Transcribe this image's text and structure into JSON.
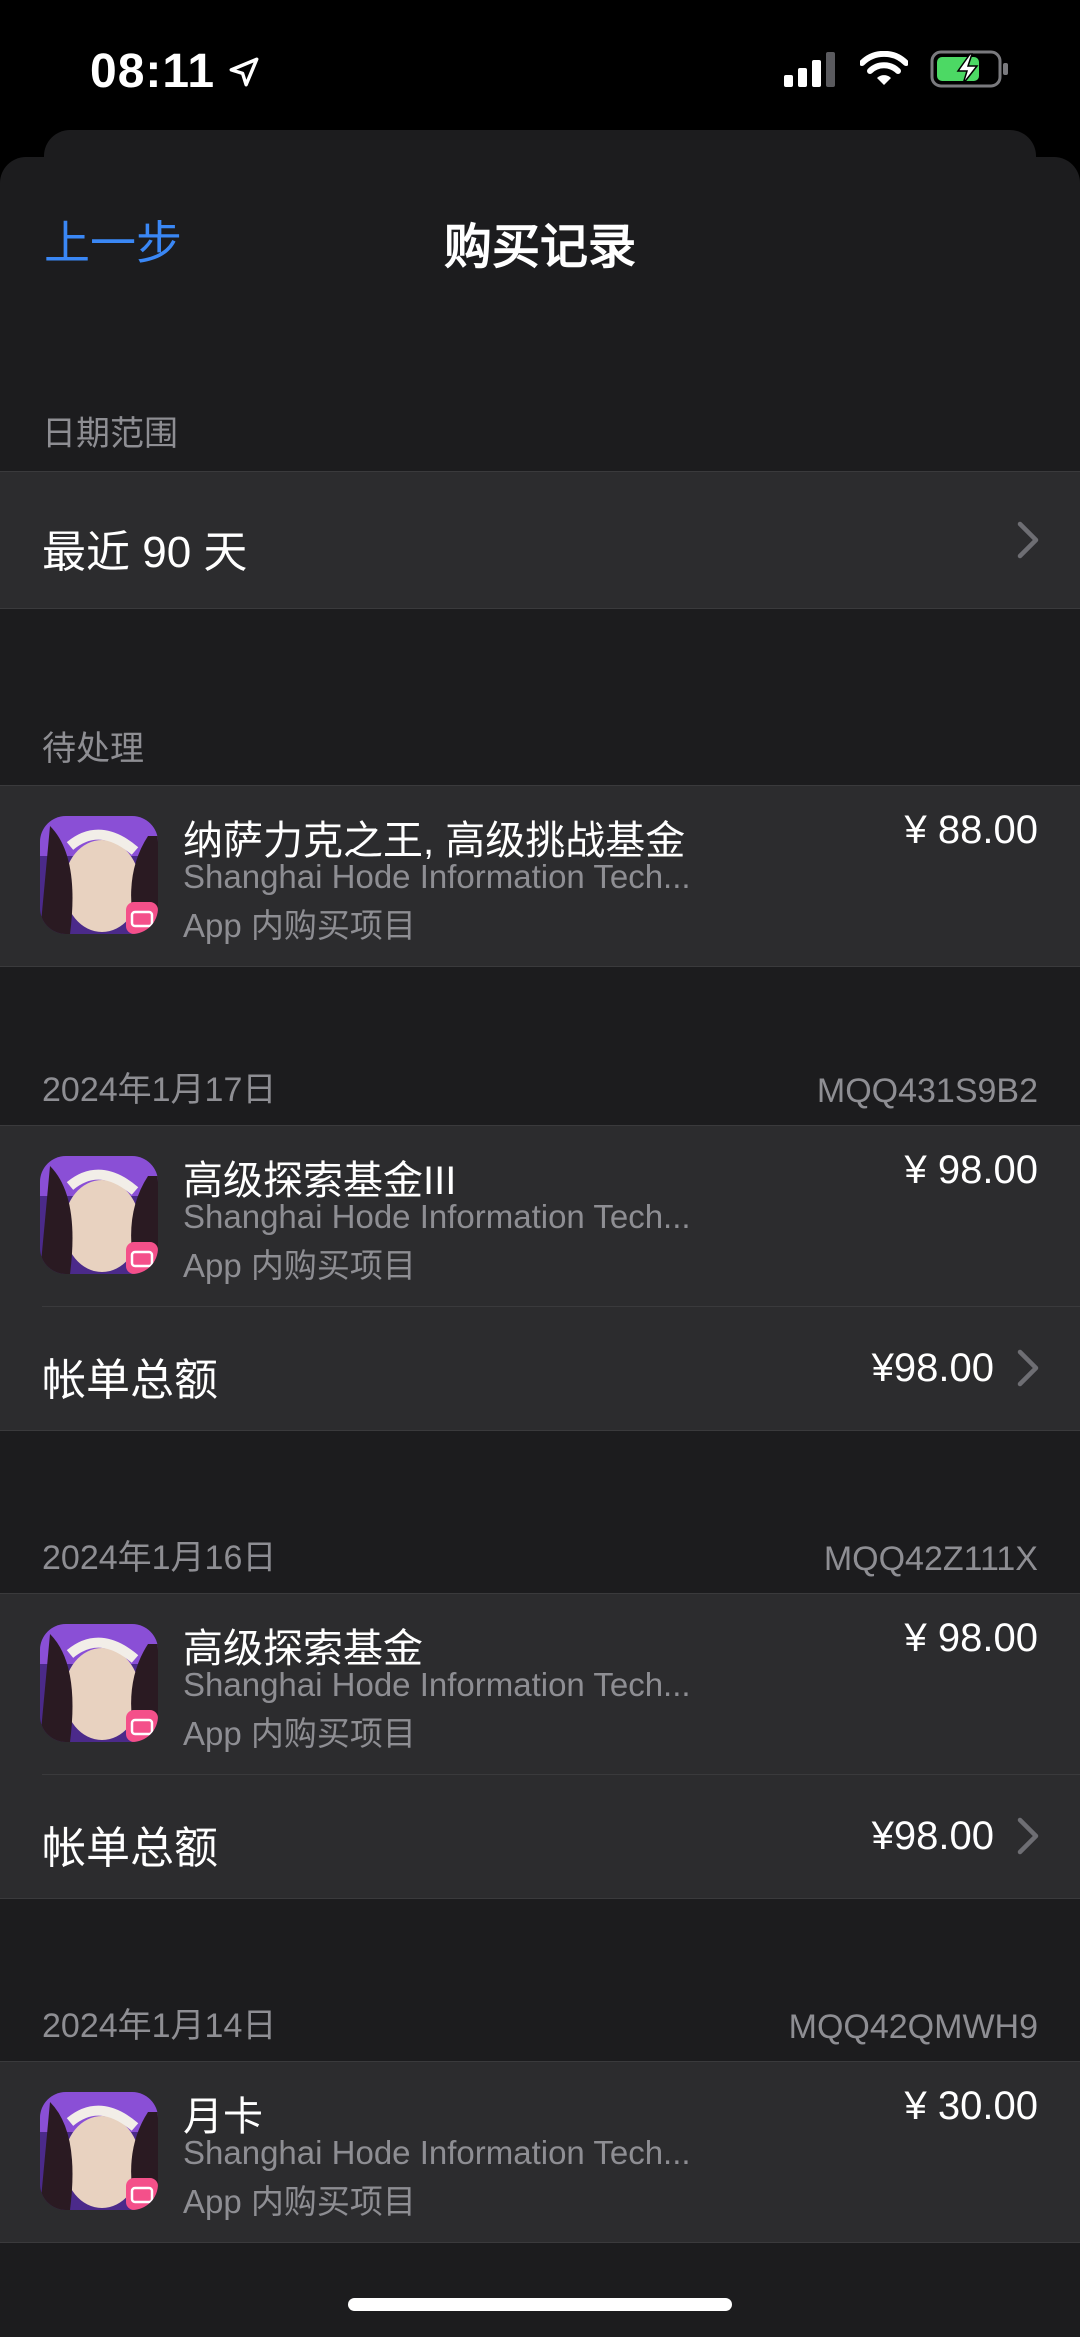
{
  "status_bar": {
    "time": "08:11"
  },
  "nav": {
    "back_label": "上一步",
    "title": "购买记录"
  },
  "date_range": {
    "header": "日期范围",
    "value": "最近 90 天"
  },
  "pending": {
    "header": "待处理",
    "item": {
      "name": "纳萨力克之王, 高级挑战基金",
      "seller": "Shanghai Hode Information Tech...",
      "kind": "App 内购买项目",
      "price": "¥ 88.00"
    }
  },
  "orders": [
    {
      "date": "2024年1月17日",
      "order_id": "MQQ431S9B2",
      "item": {
        "name": "高级探索基金III",
        "seller": "Shanghai Hode Information Tech...",
        "kind": "App 内购买项目",
        "price": "¥ 98.00"
      },
      "total_label": "帐单总额",
      "total": "¥98.00"
    },
    {
      "date": "2024年1月16日",
      "order_id": "MQQ42Z111X",
      "item": {
        "name": "高级探索基金",
        "seller": "Shanghai Hode Information Tech...",
        "kind": "App 内购买项目",
        "price": "¥ 98.00"
      },
      "total_label": "帐单总额",
      "total": "¥98.00"
    },
    {
      "date": "2024年1月14日",
      "order_id": "MQQ42QMWH9",
      "item": {
        "name": "月卡",
        "seller": "Shanghai Hode Information Tech...",
        "kind": "App 内购买项目",
        "price": "¥ 30.00"
      }
    }
  ],
  "colors": {
    "accent": "#3a87f5",
    "background": "#1c1c1e",
    "cell": "#2c2c2e",
    "secondary_text": "#8e8e93",
    "battery_green": "#4cd964"
  },
  "icons": [
    "location-arrow-icon",
    "cellular-signal-icon",
    "wifi-icon",
    "battery-charging-icon",
    "chevron-right-icon",
    "app-icon"
  ]
}
